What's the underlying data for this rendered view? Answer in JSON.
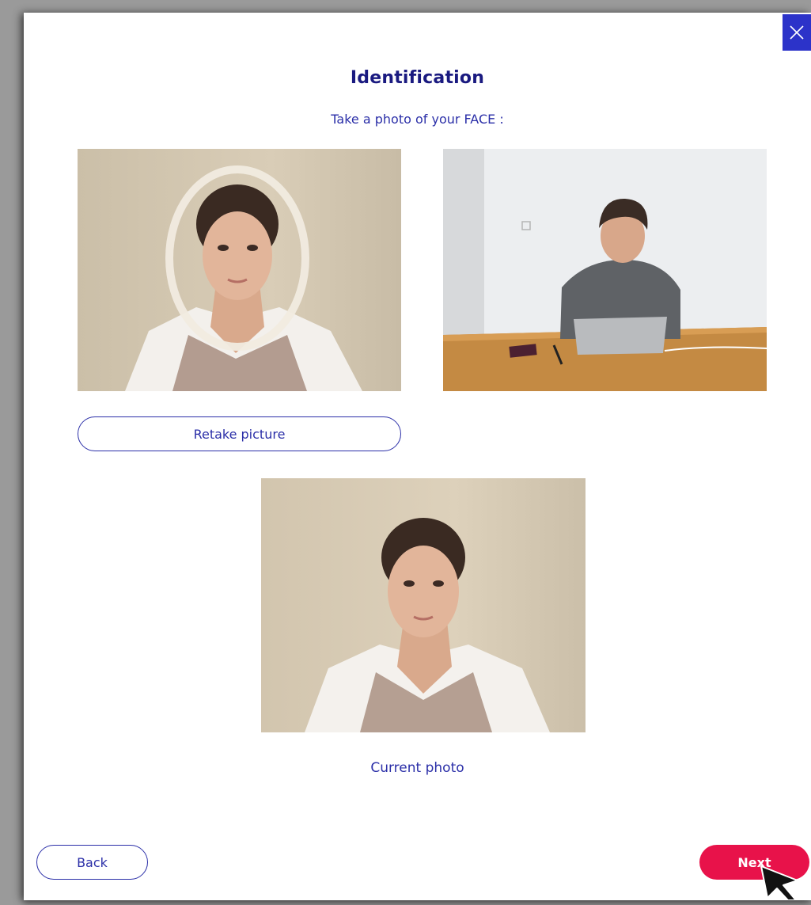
{
  "dialog": {
    "title": "Identification",
    "instruction": "Take a photo of your FACE :",
    "retake_label": "Retake picture",
    "current_caption": "Current photo",
    "back_label": "Back",
    "next_label": "Next"
  },
  "colors": {
    "accent": "#2c33c9",
    "title": "#1a1a80",
    "primary_button": "#e8124a"
  },
  "icons": {
    "close": "close-icon",
    "cursor": "mouse-pointer"
  }
}
